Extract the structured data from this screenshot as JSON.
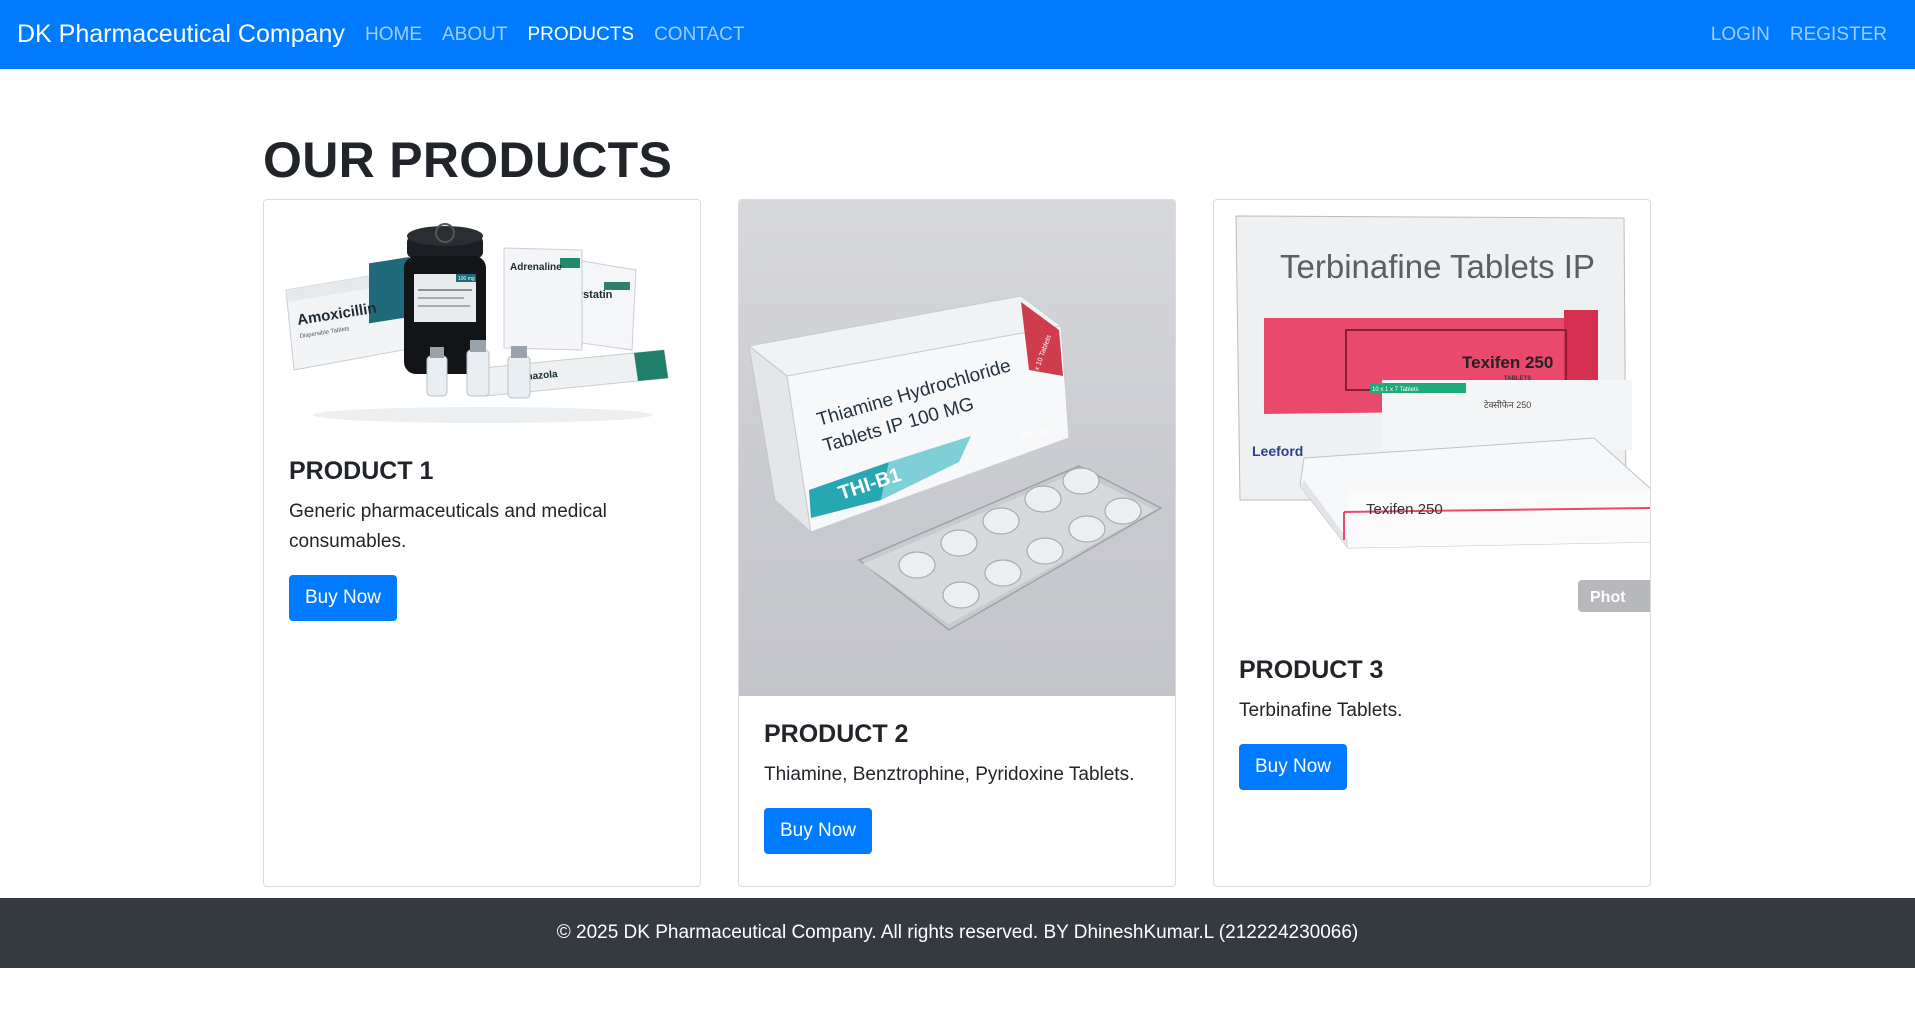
{
  "navbar": {
    "brand": "DK Pharmaceutical Company",
    "left_links": [
      "HOME",
      "ABOUT",
      "PRODUCTS",
      "CONTACT"
    ],
    "active_link": "PRODUCTS",
    "right_links": [
      "LOGIN",
      "REGISTER"
    ]
  },
  "page": {
    "title": "OUR PRODUCTS"
  },
  "products": [
    {
      "title": "PRODUCT 1",
      "description": "Generic pharmaceuticals and medical consumables.",
      "button_label": "Buy Now",
      "image_labels": {
        "box_main": "Amoxicillin",
        "box_sub": "Dispersible Tablets",
        "box_b": "Adrenaline",
        "box_c": "Nystatin",
        "tube": "mazola",
        "jar": "100 mg"
      }
    },
    {
      "title": "PRODUCT 2",
      "description": "Thiamine, Benztrophine, Pyridoxine Tablets.",
      "button_label": "Buy Now",
      "image_labels": {
        "line1": "Thiamine Hydrochloride",
        "line2": "Tablets IP 100 MG",
        "brand": "THI-B1",
        "dose": "100 mg",
        "pack": "10 x 10 Tablets"
      }
    },
    {
      "title": "PRODUCT 3",
      "description": "Terbinafine Tablets.",
      "button_label": "Buy Now",
      "image_labels": {
        "heading": "Terbinafine Tablets IP",
        "brand": "Texifen 250",
        "sub": "TABLETS",
        "pack": "10 x 1 x 7 Tablets",
        "maker": "Leeford",
        "hindi": "टेक्सीफेन 250",
        "box2": "Texifen 250",
        "watermark": "Phot"
      }
    }
  ],
  "footer": {
    "text": "© 2025 DK Pharmaceutical Company. All rights reserved. BY DhineshKumar.L (212224230066)"
  },
  "colors": {
    "primary": "#007bff",
    "footer_bg": "#343a40",
    "text": "#212529"
  }
}
